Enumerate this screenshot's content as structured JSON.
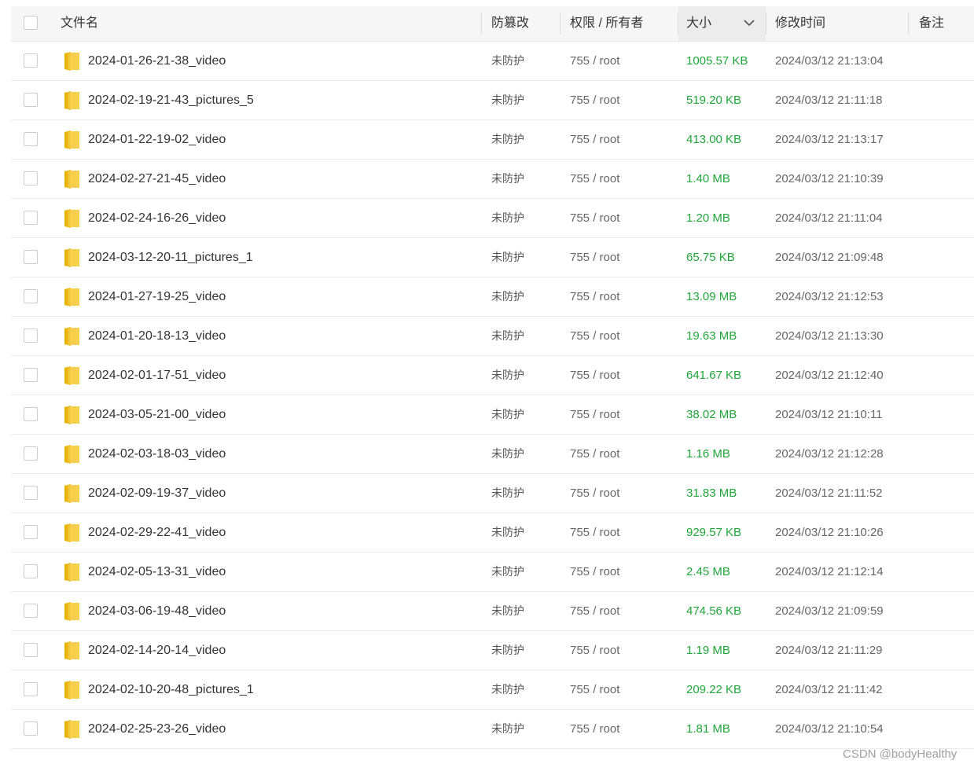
{
  "columns": {
    "name": "文件名",
    "protect": "防篡改",
    "perm": "权限 / 所有者",
    "size": "大小",
    "mtime": "修改时间",
    "note": "备注"
  },
  "rows": [
    {
      "name": "2024-01-26-21-38_video",
      "protect": "未防护",
      "perm": "755 / root",
      "size": "1005.57 KB",
      "mtime": "2024/03/12 21:13:04"
    },
    {
      "name": "2024-02-19-21-43_pictures_5",
      "protect": "未防护",
      "perm": "755 / root",
      "size": "519.20 KB",
      "mtime": "2024/03/12 21:11:18"
    },
    {
      "name": "2024-01-22-19-02_video",
      "protect": "未防护",
      "perm": "755 / root",
      "size": "413.00 KB",
      "mtime": "2024/03/12 21:13:17"
    },
    {
      "name": "2024-02-27-21-45_video",
      "protect": "未防护",
      "perm": "755 / root",
      "size": "1.40 MB",
      "mtime": "2024/03/12 21:10:39"
    },
    {
      "name": "2024-02-24-16-26_video",
      "protect": "未防护",
      "perm": "755 / root",
      "size": "1.20 MB",
      "mtime": "2024/03/12 21:11:04"
    },
    {
      "name": "2024-03-12-20-11_pictures_1",
      "protect": "未防护",
      "perm": "755 / root",
      "size": "65.75 KB",
      "mtime": "2024/03/12 21:09:48"
    },
    {
      "name": "2024-01-27-19-25_video",
      "protect": "未防护",
      "perm": "755 / root",
      "size": "13.09 MB",
      "mtime": "2024/03/12 21:12:53"
    },
    {
      "name": "2024-01-20-18-13_video",
      "protect": "未防护",
      "perm": "755 / root",
      "size": "19.63 MB",
      "mtime": "2024/03/12 21:13:30"
    },
    {
      "name": "2024-02-01-17-51_video",
      "protect": "未防护",
      "perm": "755 / root",
      "size": "641.67 KB",
      "mtime": "2024/03/12 21:12:40"
    },
    {
      "name": "2024-03-05-21-00_video",
      "protect": "未防护",
      "perm": "755 / root",
      "size": "38.02 MB",
      "mtime": "2024/03/12 21:10:11"
    },
    {
      "name": "2024-02-03-18-03_video",
      "protect": "未防护",
      "perm": "755 / root",
      "size": "1.16 MB",
      "mtime": "2024/03/12 21:12:28"
    },
    {
      "name": "2024-02-09-19-37_video",
      "protect": "未防护",
      "perm": "755 / root",
      "size": "31.83 MB",
      "mtime": "2024/03/12 21:11:52"
    },
    {
      "name": "2024-02-29-22-41_video",
      "protect": "未防护",
      "perm": "755 / root",
      "size": "929.57 KB",
      "mtime": "2024/03/12 21:10:26"
    },
    {
      "name": "2024-02-05-13-31_video",
      "protect": "未防护",
      "perm": "755 / root",
      "size": "2.45 MB",
      "mtime": "2024/03/12 21:12:14"
    },
    {
      "name": "2024-03-06-19-48_video",
      "protect": "未防护",
      "perm": "755 / root",
      "size": "474.56 KB",
      "mtime": "2024/03/12 21:09:59"
    },
    {
      "name": "2024-02-14-20-14_video",
      "protect": "未防护",
      "perm": "755 / root",
      "size": "1.19 MB",
      "mtime": "2024/03/12 21:11:29"
    },
    {
      "name": "2024-02-10-20-48_pictures_1",
      "protect": "未防护",
      "perm": "755 / root",
      "size": "209.22 KB",
      "mtime": "2024/03/12 21:11:42"
    },
    {
      "name": "2024-02-25-23-26_video",
      "protect": "未防护",
      "perm": "755 / root",
      "size": "1.81 MB",
      "mtime": "2024/03/12 21:10:54"
    }
  ],
  "icons": {
    "folder": "folder-icon",
    "sort": "chevron-down-icon"
  },
  "colors": {
    "size": "#20a53a",
    "folder": "#f5c518"
  },
  "watermark": "CSDN @bodyHealthy"
}
